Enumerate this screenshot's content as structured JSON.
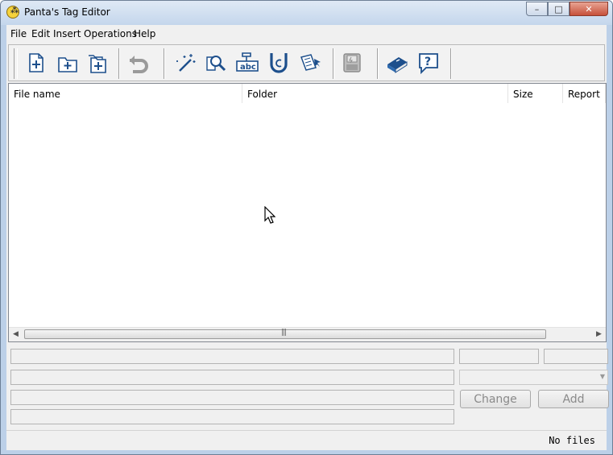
{
  "window": {
    "title": "Panta's Tag Editor",
    "min": "–",
    "max": "□",
    "close": "✕"
  },
  "menu": [
    "File",
    "Edit",
    "Insert",
    "Operations",
    "Help"
  ],
  "toolbar": {
    "icons": [
      "new-file-icon",
      "new-folder-icon",
      "add-files-icon",
      "undo-icon",
      "magic-wand-icon",
      "find-icon",
      "rename-abc-icon",
      "unicode-icon",
      "edit-tags-icon",
      "save-icon",
      "help-book-icon",
      "about-icon"
    ],
    "abc": "abc"
  },
  "list": {
    "columns": [
      "File name",
      "Folder",
      "Size",
      "Report"
    ],
    "rows": []
  },
  "editor": {
    "change_label": "Change",
    "add_label": "Add"
  },
  "status": {
    "text": "No files"
  }
}
